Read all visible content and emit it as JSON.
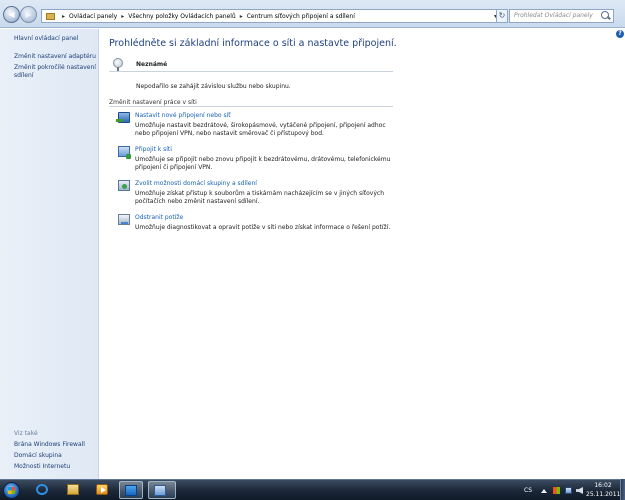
{
  "breadcrumb": [
    "Ovládací panely",
    "Všechny položky Ovládacích panelů",
    "Centrum síťových připojení a sdílení"
  ],
  "search": {
    "placeholder": "Prohledat Ovládací panely"
  },
  "sidebar": {
    "links": [
      "Hlavní ovládací panel",
      "Změnit nastavení adaptéru",
      "Změnit pokročilé nastavení sdílení"
    ],
    "see_also_heading": "Viz také",
    "see_also": [
      "Brána Windows Firewall",
      "Domácí skupina",
      "Možnosti Internetu"
    ]
  },
  "main": {
    "title": "Prohlédněte si základní informace o síti a nastavte připojení.",
    "network_name": "Neznámé",
    "no_service": "Nepodařilo se zahájit  závislou službu nebo skupinu.",
    "section_heading": "Změnit nastavení práce v síti",
    "tasks": [
      {
        "icon": "new-connection-icon",
        "link": "Nastavit nové připojení nebo síť",
        "desc": "Umožňuje nastavit bezdrátové, širokopásmové, vytáčené připojení, připojení adhoc nebo připojení VPN, nebo nastavit směrovač či přístupový bod."
      },
      {
        "icon": "connect-network-icon",
        "link": "Připojit k síti",
        "desc": "Umožňuje se připojit nebo znovu připojit k bezdrátovému, drátovému, telefonickému připojení či připojení VPN."
      },
      {
        "icon": "homegroup-icon",
        "link": "Zvolit možnosti domácí skupiny a sdílení",
        "desc": "Umožňuje získat přístup k souborům a tiskárnám nacházejícím se v jiných síťových počítačích nebo změnit nastavení sdílení."
      },
      {
        "icon": "troubleshoot-icon",
        "link": "Odstranit potíže",
        "desc": "Umožňuje diagnostikovat a opravit potíže v síti nebo získat informace o řešení potíží."
      }
    ]
  },
  "taskbar": {
    "language": "CS",
    "time": "16:02",
    "date": "25.11.2011"
  }
}
